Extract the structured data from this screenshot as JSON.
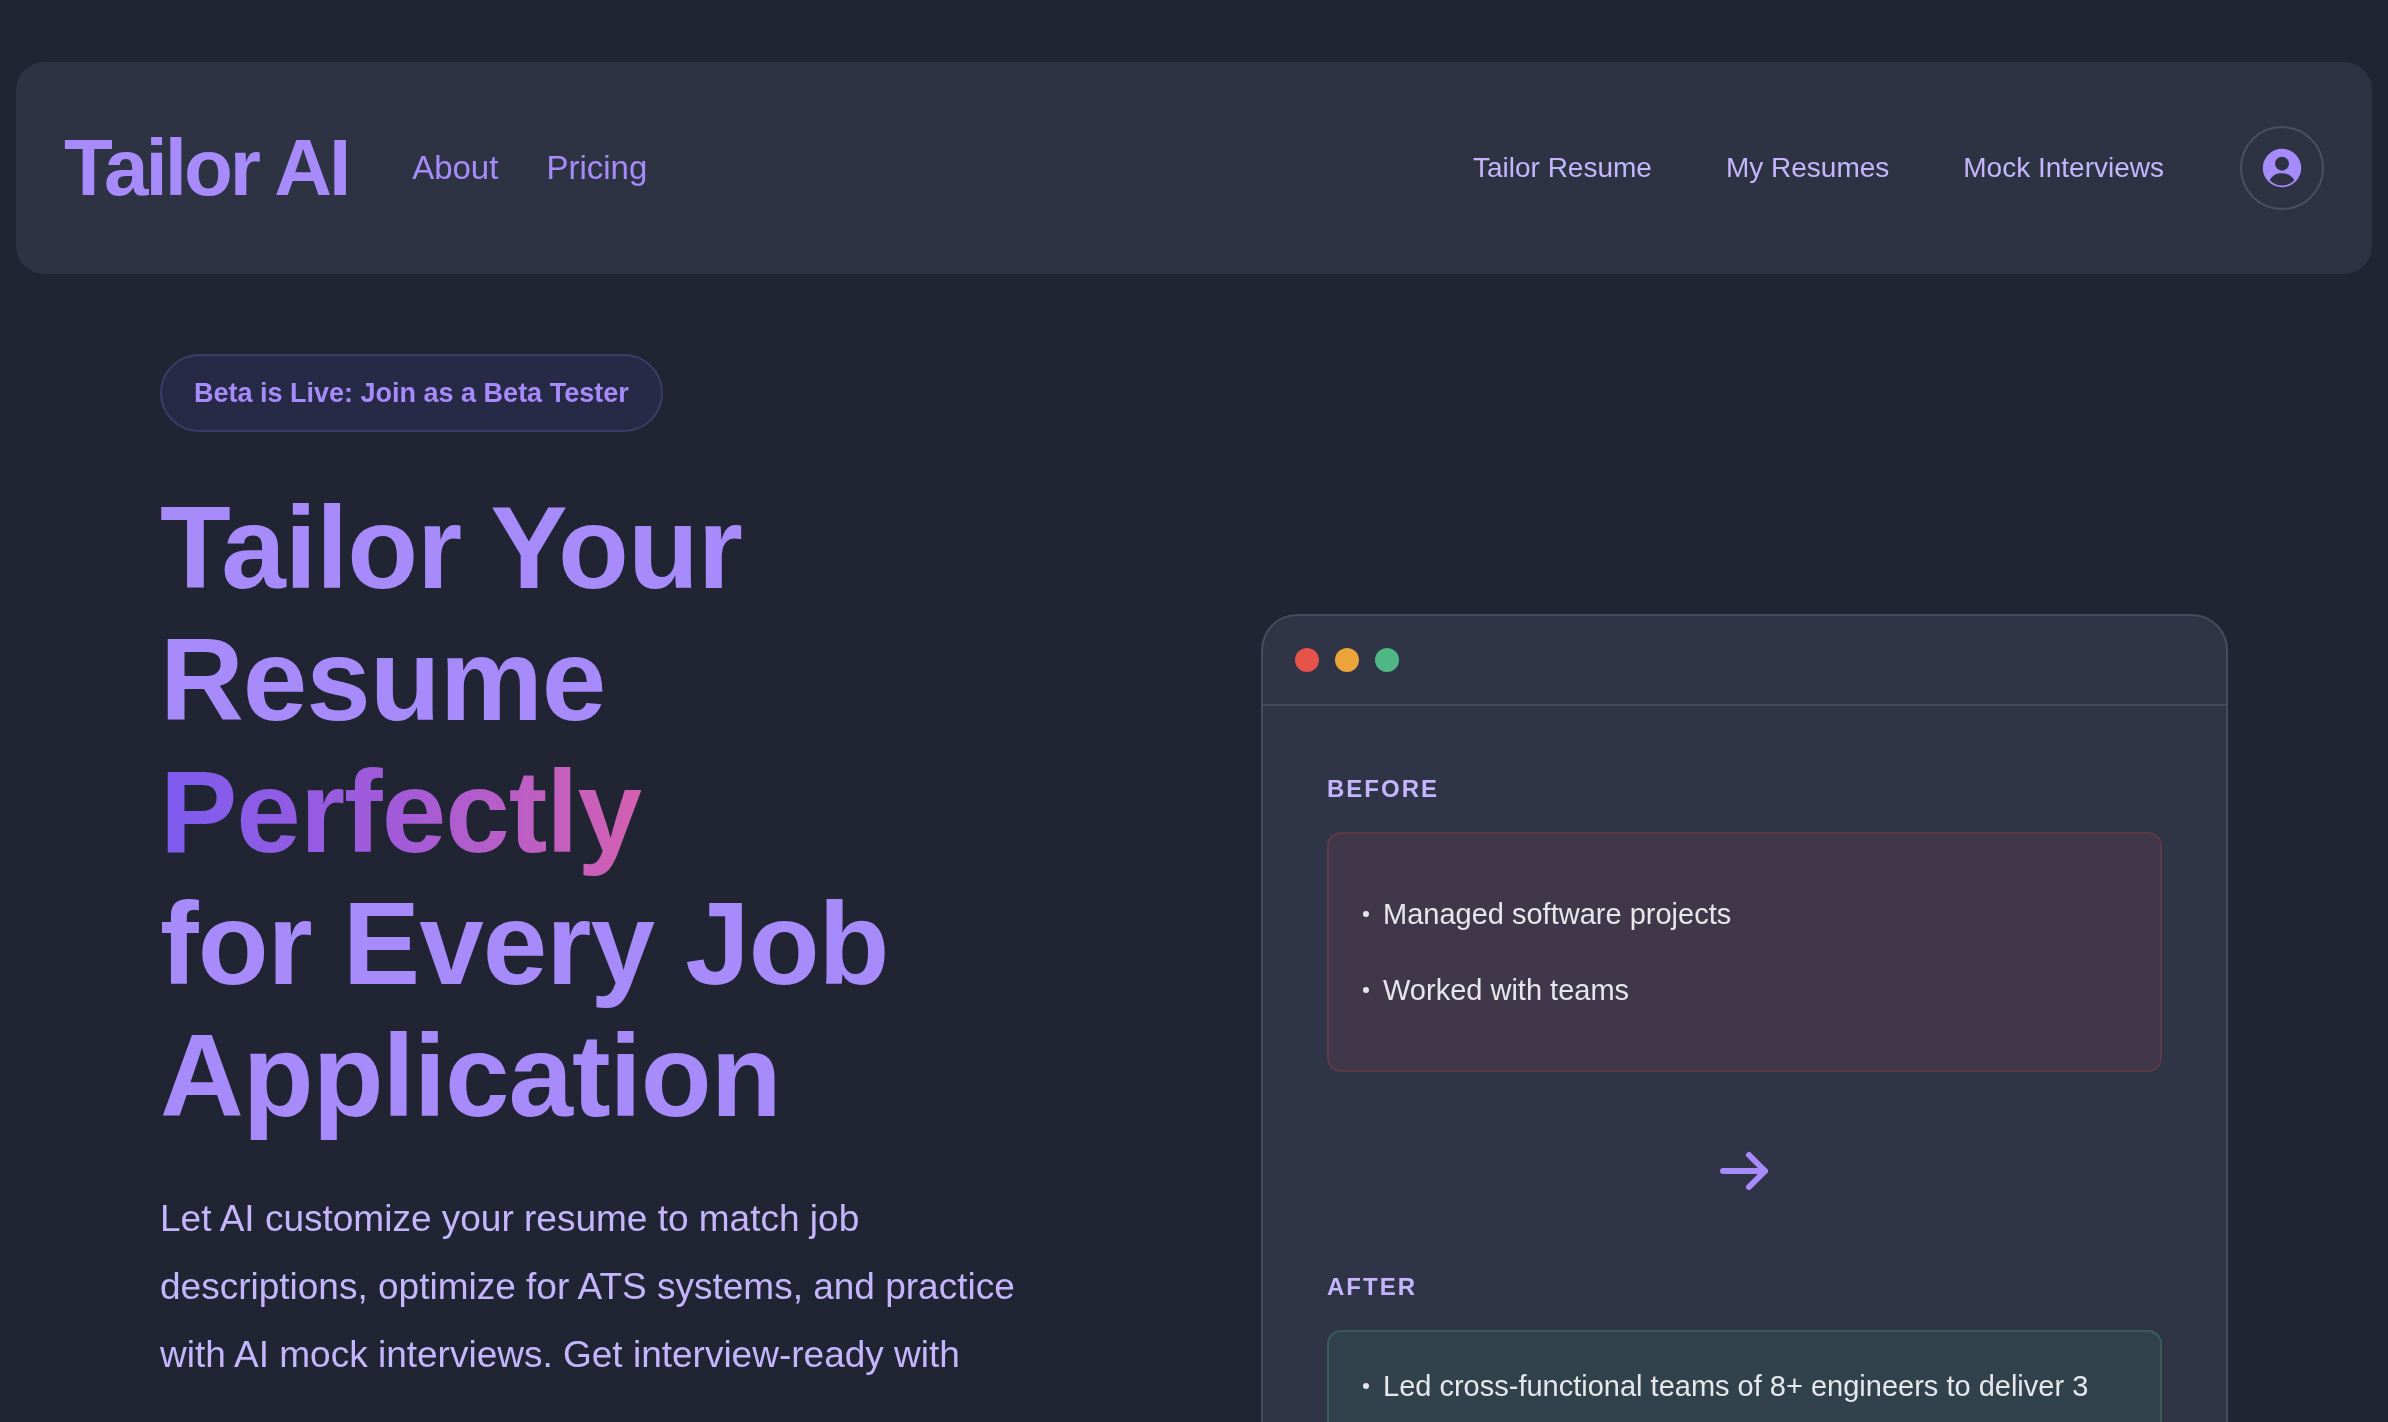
{
  "brand": "Tailor AI",
  "nav_left": [
    "About",
    "Pricing"
  ],
  "nav_right": [
    "Tailor Resume",
    "My Resumes",
    "Mock Interviews"
  ],
  "badge": "Beta is Live: Join as a Beta Tester",
  "headline": [
    {
      "text": "Tailor Your",
      "kind": "plain"
    },
    {
      "text": "Resume",
      "kind": "plain"
    },
    {
      "text": "Perfectly",
      "kind": "gradient"
    },
    {
      "text": "for Every Job",
      "kind": "plain"
    },
    {
      "text": "Application",
      "kind": "plain"
    }
  ],
  "description": "Let AI customize your resume to match job descriptions, optimize for ATS systems, and practice with AI mock interviews. Get interview-ready with",
  "preview": {
    "window_dots": [
      {
        "color": "#e5534b"
      },
      {
        "color": "#eaa43a"
      },
      {
        "color": "#4fb783"
      }
    ],
    "sections": [
      {
        "label": "BEFORE",
        "kind": "before",
        "items": [
          "Managed software projects",
          "Worked with teams"
        ]
      },
      {
        "label": "AFTER",
        "kind": "after",
        "items": [
          "Led cross-functional teams of 8+ engineers to deliver 3"
        ]
      }
    ]
  }
}
